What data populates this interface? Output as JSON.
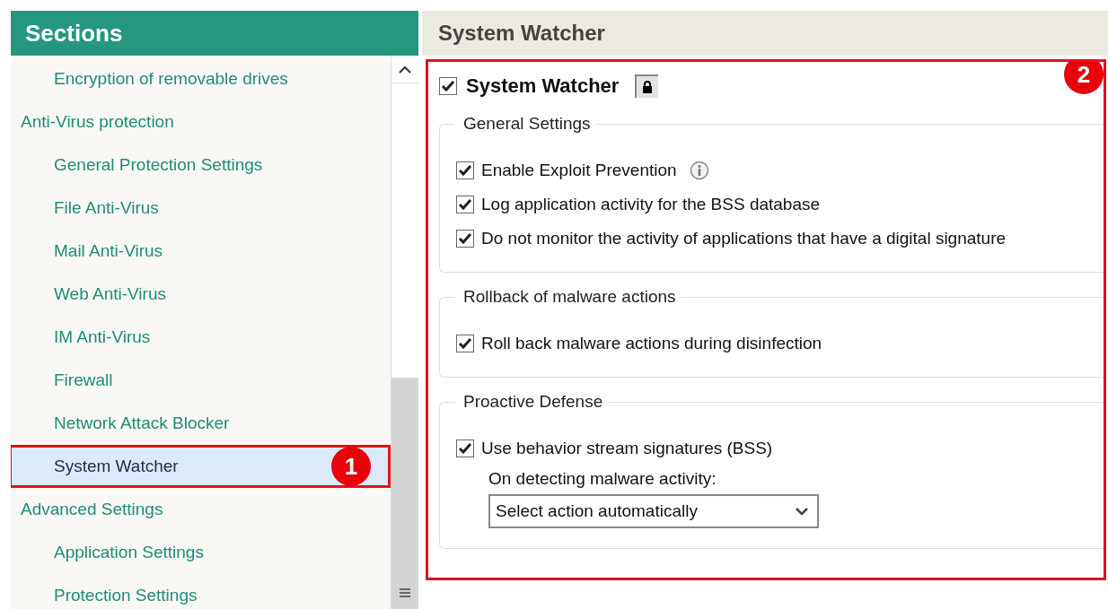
{
  "sidebar": {
    "title": "Sections",
    "items": [
      {
        "children": [
          {
            "label": "Encryption of removable drives",
            "selected": false
          }
        ]
      },
      {
        "label": "Anti-Virus protection",
        "selected": false,
        "children": [
          {
            "label": "General Protection Settings",
            "selected": false
          },
          {
            "label": "File Anti-Virus",
            "selected": false
          },
          {
            "label": "Mail Anti-Virus",
            "selected": false
          },
          {
            "label": "Web Anti-Virus",
            "selected": false
          },
          {
            "label": "IM Anti-Virus",
            "selected": false
          },
          {
            "label": "Firewall",
            "selected": false
          },
          {
            "label": "Network Attack Blocker",
            "selected": false
          },
          {
            "label": "System Watcher",
            "selected": true,
            "callout": "1"
          }
        ]
      },
      {
        "label": "Advanced Settings",
        "selected": false,
        "children": [
          {
            "label": "Application Settings",
            "selected": false
          },
          {
            "label": "Protection Settings",
            "selected": false
          }
        ]
      }
    ]
  },
  "main": {
    "header": "System Watcher",
    "callout": "2",
    "enabled": {
      "label": "System Watcher",
      "checked": true,
      "locked": true
    },
    "groups": [
      {
        "legend": "General Settings",
        "controls": [
          {
            "kind": "checkbox",
            "label": "Enable Exploit Prevention",
            "checked": true,
            "info": true
          },
          {
            "kind": "checkbox",
            "label": "Log application activity for the BSS database",
            "checked": true
          },
          {
            "kind": "checkbox",
            "label": "Do not monitor the activity of applications that have a digital signature",
            "checked": true
          }
        ]
      },
      {
        "legend": "Rollback of malware actions",
        "controls": [
          {
            "kind": "checkbox",
            "label": "Roll back malware actions during disinfection",
            "checked": true
          }
        ]
      },
      {
        "legend": "Proactive Defense",
        "controls": [
          {
            "kind": "checkbox",
            "label": "Use behavior stream signatures (BSS)",
            "checked": true
          },
          {
            "kind": "label",
            "label": "On detecting malware activity:"
          },
          {
            "kind": "dropdown",
            "value": "Select action automatically"
          }
        ]
      }
    ]
  }
}
